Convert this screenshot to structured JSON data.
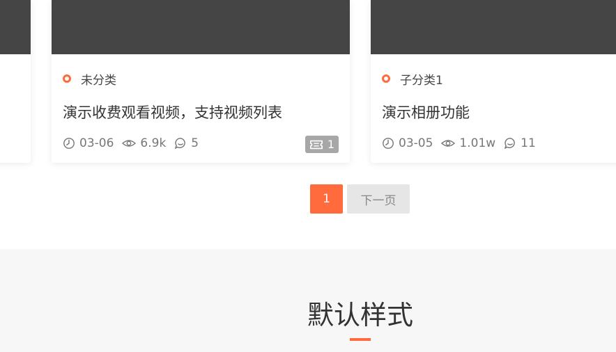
{
  "cards": [
    {
      "category": "未分类",
      "title": "演示收费观看视频，支持视频列表",
      "date": "03-06",
      "views": "6.9k",
      "comments": "5",
      "badge": "1"
    },
    {
      "category": "子分类1",
      "title": "演示相册功能",
      "date": "03-05",
      "views": "1.01w",
      "comments": "11"
    }
  ],
  "pagination": {
    "current": "1",
    "next_label": "下一页"
  },
  "section": {
    "title": "默认样式"
  },
  "colors": {
    "accent": "#ff6b3d",
    "thumb": "#454545",
    "badge": "#a7a7a7"
  },
  "icons": [
    "clock-icon",
    "eye-icon",
    "comment-icon",
    "ticket-icon"
  ]
}
